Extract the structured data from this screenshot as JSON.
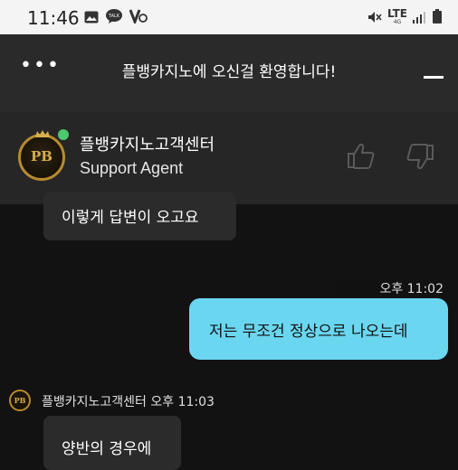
{
  "status_bar": {
    "time": "11:46",
    "network": "LTE",
    "network_sub": "4G",
    "icons_left": [
      "gallery-icon",
      "talk-icon",
      "v3-icon"
    ],
    "icons_right": [
      "mute-icon",
      "signal-icon",
      "battery-icon"
    ]
  },
  "header": {
    "menu": "•••",
    "title": "플뱅카지노에 오신걸 환영합니다!"
  },
  "agent": {
    "name": "플뱅카지노고객센터",
    "role": "Support Agent",
    "avatar_text": "PB",
    "status": "online"
  },
  "messages": [
    {
      "from": "agent",
      "text": "이렇게 답변이 오고요"
    },
    {
      "from": "user",
      "time": "오후 11:02",
      "text": "저는 무조건 정상으로 나오는데"
    },
    {
      "from": "agent",
      "sender": "플뱅카지노고객센터 오후 11:03",
      "text": "양반의 경우에"
    }
  ],
  "colors": {
    "user_bubble": "#6bd6f0",
    "agent_bubble": "#2b2b2b",
    "online": "#4cc86d",
    "gold": "#b88a2e"
  }
}
